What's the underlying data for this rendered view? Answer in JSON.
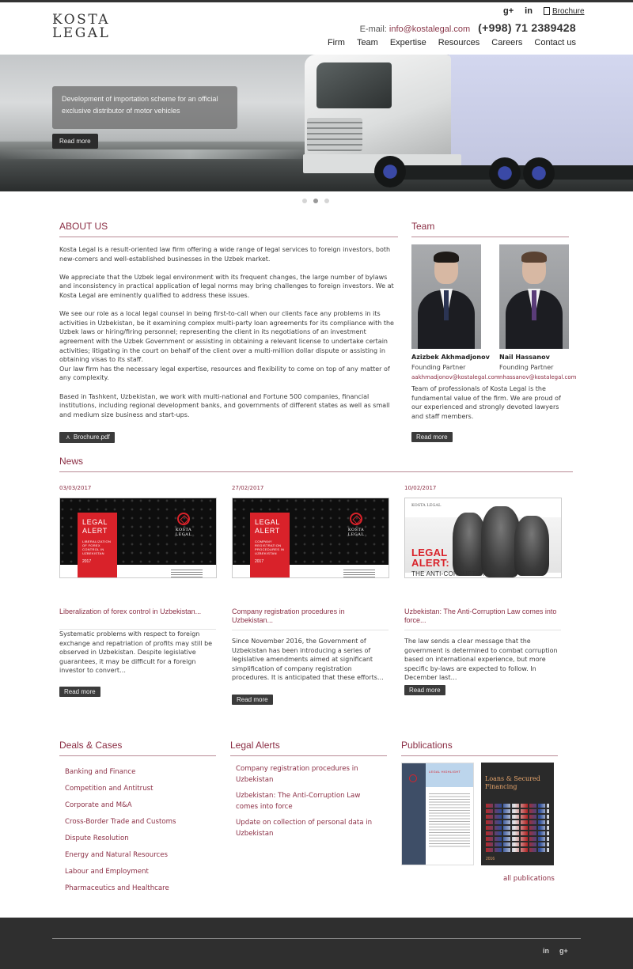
{
  "header": {
    "logo_line1": "KOSTA",
    "logo_line2": "LEGAL",
    "social": {
      "google_plus": "g+",
      "linkedin": "in"
    },
    "brochure_label": "Brochure",
    "email_label": "E-mail:",
    "email_value": "info@kostalegal.com",
    "phone": "(+998) 71 2389428",
    "nav": [
      "Firm",
      "Team",
      "Expertise",
      "Resources",
      "Careers",
      "Contact us"
    ]
  },
  "hero": {
    "caption": "Development of importation scheme for an official exclusive distributor of motor vehicles",
    "read_more": "Read more",
    "slide_count": 3,
    "active_slide": 2
  },
  "about": {
    "title": "ABOUT US",
    "paragraphs": [
      "Kosta Legal is a result-oriented law firm offering a wide range of legal services to foreign investors, both new-comers and well-established businesses in the Uzbek market.",
      "We appreciate that the Uzbek legal environment with its frequent changes, the large number of bylaws and inconsistency in practical application of legal norms may bring challenges to foreign investors. We at Kosta Legal are eminently qualified to address these issues.",
      "We see our role as a local legal counsel in being first-to-call when our clients face any problems in its activities in Uzbekistan, be it examining complex multi-party loan agreements for its compliance with the Uzbek laws or hiring/firing personnel; representing the client in its negotiations of an investment agreement with the Uzbek Government or assisting in obtaining a relevant license to undertake certain activities; litigating in the court on behalf of the client over a multi-million dollar dispute or assisting in obtaining visas to its staff.",
      "Our law firm has the necessary legal expertise, resources and flexibility to come on top of any matter of any complexity.",
      "Based in Tashkent, Uzbekistan, we work with multi-national and Fortune 500 companies, financial institutions, including regional development banks, and governments of different states as well as small and medium size business and start-ups."
    ],
    "brochure_button": "Brochure.pdf"
  },
  "team": {
    "title": "Team",
    "members": [
      {
        "name": "Azizbek Akhmadjonov",
        "role": "Founding Partner",
        "email": "aakhmadjonov@kostalegal.com"
      },
      {
        "name": "Nail Hassanov",
        "role": "Founding Partner",
        "email": "nhassanov@kostalegal.com"
      }
    ],
    "description": "Team of professionals of Kosta Legal is the fundamental value of the firm. We are proud of our experienced and strongly devoted lawyers and staff members.",
    "read_more": "Read more"
  },
  "news": {
    "title": "News",
    "items": [
      {
        "date": "03/03/2017",
        "image": {
          "alert_title": "LEGAL ALERT",
          "alert_subtitle": "LIBERALIZATION OF FOREX CONTROL IN UZBEKISTAN",
          "year": "2017",
          "brand": "KOSTA LEGAL"
        },
        "title": "Liberalization of forex control in Uzbekistan...",
        "text": "Systematic problems with respect to foreign exchange and repatriation of profits may still be observed in Uzbekistan. Despite legislative guarantees, it may be difficult for a foreign investor to convert…",
        "read_more": "Read more"
      },
      {
        "date": "27/02/2017",
        "image": {
          "alert_title": "LEGAL ALERT",
          "alert_subtitle": "COMPANY REGISTRATION PROCEDURES IN UZBEKISTAN",
          "year": "2017",
          "brand": "KOSTA LEGAL"
        },
        "title": "Company registration procedures in Uzbekistan...",
        "text": "Since November 2016, the Government of Uzbekistan has been introducing a series of legislative amendments aimed at significant simplification of company registration procedures.   It is anticipated that these efforts…",
        "read_more": "Read more"
      },
      {
        "date": "10/02/2017",
        "image": {
          "brand": "KOSTA LEGAL",
          "alert_title": "LEGAL ALERT:",
          "alert_subtitle": "THE ANTI-CORRUPTION LAW COMES INTO FORCE"
        },
        "title": "Uzbekistan: The Anti-Corruption Law comes into force...",
        "text": "The law sends a clear message that the government is determined to combat corruption based on international experience, but more specific by-laws are expected to follow.   In December last…",
        "read_more": "Read more"
      }
    ]
  },
  "deals": {
    "title": "Deals & Cases",
    "items": [
      "Banking and Finance",
      "Competition and Antitrust",
      "Corporate and M&A",
      "Cross-Border Trade and Customs",
      "Dispute Resolution",
      "Energy and Natural Resources",
      "Labour and Employment",
      "Pharmaceutics and Healthcare"
    ]
  },
  "alerts": {
    "title": "Legal Alerts",
    "items": [
      "Company registration procedures in Uzbekistan",
      "Uzbekistan: The Anti-Corruption Law comes into force",
      "Update on collection of personal data in Uzbekistan"
    ]
  },
  "publications": {
    "title": "Publications",
    "cover1_label": "LEGAL HIGHLIGHT",
    "cover2_title": "Loans & Secured Financing",
    "cover2_year": "2016",
    "all_label": "all publications"
  },
  "footer": {
    "linkedin": "in",
    "google_plus": "g+"
  },
  "colors": {
    "accent": "#8b2e44",
    "button": "#3b3b3b",
    "footer": "#2f2f2f",
    "alert_red": "#d9222a"
  }
}
